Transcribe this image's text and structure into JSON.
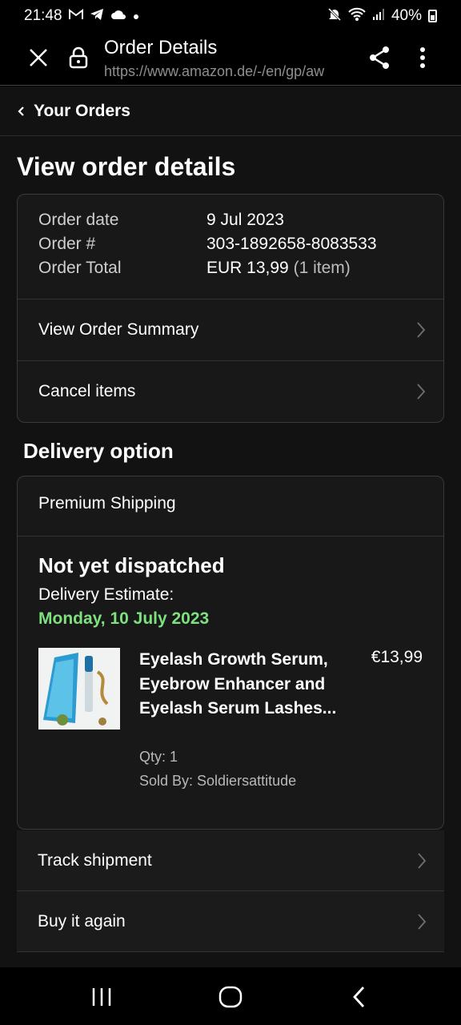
{
  "status_bar": {
    "time": "21:48",
    "left_icons": [
      "gmail-icon",
      "telegram-icon",
      "cloud-icon",
      "dot-icon"
    ],
    "right_icons": [
      "mute-icon",
      "wifi-icon",
      "signal-icon"
    ],
    "battery": "40%"
  },
  "browser": {
    "title": "Order Details",
    "url": "https://www.amazon.de/-/en/gp/aw",
    "icons": [
      "close-icon",
      "lock-icon",
      "share-icon",
      "more-vert-icon"
    ]
  },
  "breadcrumb": {
    "back_label": "Your Orders"
  },
  "page_title": "View order details",
  "order": {
    "date_label": "Order date",
    "date_value": "9 Jul 2023",
    "number_label": "Order #",
    "number_value": "303-1892658-8083533",
    "total_label": "Order Total",
    "total_value": "EUR 13,99",
    "total_items": "(1 item)"
  },
  "order_actions": {
    "view_summary": "View Order Summary",
    "cancel_items": "Cancel items"
  },
  "delivery": {
    "heading": "Delivery option",
    "shipping_type": "Premium Shipping",
    "status": "Not yet dispatched",
    "estimate_label": "Delivery Estimate:",
    "estimate_date": "Monday, 10 July 2023",
    "accent_color": "#7ee07e"
  },
  "item": {
    "name": "Eyelash Growth Serum, Eyebrow Enhancer and Eyelash Serum Lashes...",
    "price": "€13,99",
    "qty": "Qty: 1",
    "sold_by": "Sold By: Soldiersattitude"
  },
  "shipment_actions": {
    "track": "Track shipment",
    "buy_again": "Buy it again"
  },
  "nav_bar": {
    "icons": [
      "recent-apps-icon",
      "home-icon",
      "back-icon"
    ]
  }
}
